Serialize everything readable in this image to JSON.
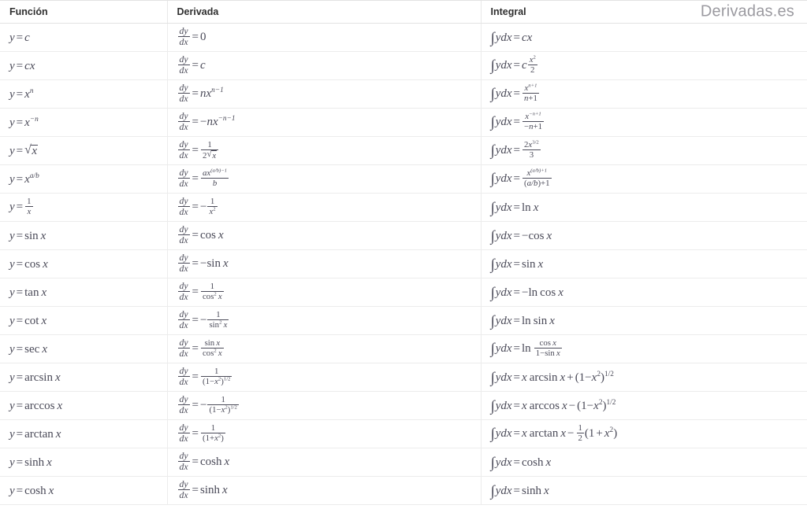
{
  "brand": "Derivadas.es",
  "table": {
    "headers": {
      "function": "Función",
      "derivative": "Derivada",
      "integral": "Integral"
    },
    "rows": [
      {
        "function": "y = c",
        "derivative": "dy/dx = 0",
        "integral": "∫ydx = cx"
      },
      {
        "function": "y = cx",
        "derivative": "dy/dx = c",
        "integral": "∫ydx = c x²/2"
      },
      {
        "function": "y = xⁿ",
        "derivative": "dy/dx = nxⁿ⁻¹",
        "integral": "∫ydx = xⁿ⁺¹/(n+1)"
      },
      {
        "function": "y = x⁻ⁿ",
        "derivative": "dy/dx = −nx⁻ⁿ⁻¹",
        "integral": "∫ydx = x⁻ⁿ⁺¹/(−n+1)"
      },
      {
        "function": "y = √x",
        "derivative": "dy/dx = 1/(2√x)",
        "integral": "∫ydx = 2x³ᐟ²/3"
      },
      {
        "function": "y = x^(a/b)",
        "derivative": "dy/dx = ax^((a/b)−1)/b",
        "integral": "∫ydx = x^((a/b)+1)/((a/b)+1)"
      },
      {
        "function": "y = 1/x",
        "derivative": "dy/dx = −1/x²",
        "integral": "∫ydx = ln x"
      },
      {
        "function": "y = sin x",
        "derivative": "dy/dx = cos x",
        "integral": "∫ydx = −cos x"
      },
      {
        "function": "y = cos x",
        "derivative": "dy/dx = −sin x",
        "integral": "∫ydx = sin x"
      },
      {
        "function": "y = tan x",
        "derivative": "dy/dx = 1/cos² x",
        "integral": "∫ydx = −ln cos x"
      },
      {
        "function": "y = cot x",
        "derivative": "dy/dx = −1/sin² x",
        "integral": "∫ydx = ln sin x"
      },
      {
        "function": "y = sec x",
        "derivative": "dy/dx = sin x/cos² x",
        "integral": "∫ydx = ln (cos x/(1−sin x))"
      },
      {
        "function": "y = arcsin x",
        "derivative": "dy/dx = 1/(1−x²)^(1/2)",
        "integral": "∫ydx = x arcsin x + (1−x²)^(1/2)"
      },
      {
        "function": "y = arccos x",
        "derivative": "dy/dx = −1/(1−x²)^(1/2)",
        "integral": "∫ydx = x arccos x − (1−x²)^(1/2)"
      },
      {
        "function": "y = arctan x",
        "derivative": "dy/dx = 1/(1+x²)",
        "integral": "∫ydx = x arctan x − ½(1+x²)"
      },
      {
        "function": "y = sinh x",
        "derivative": "dy/dx = cosh x",
        "integral": "∫ydx = cosh x"
      },
      {
        "function": "y = cosh x",
        "derivative": "dy/dx = sinh x",
        "integral": "∫ydx = sinh x"
      }
    ]
  }
}
